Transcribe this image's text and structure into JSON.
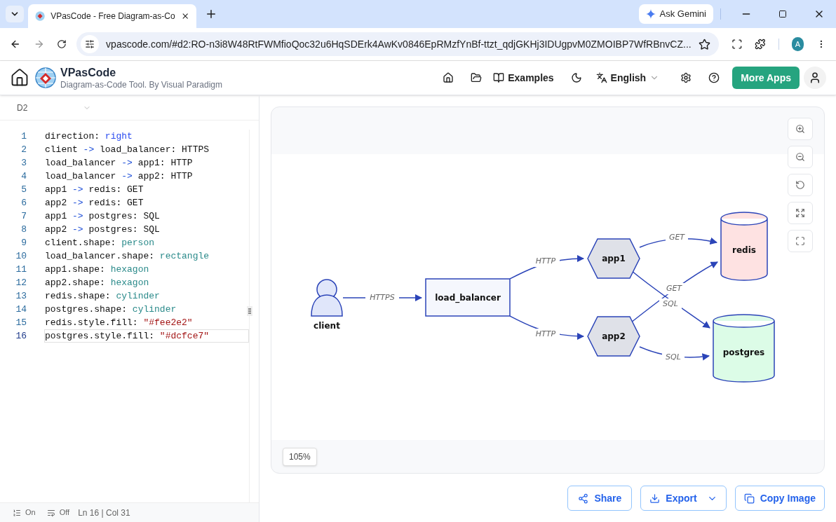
{
  "browser": {
    "tabs": [
      {
        "title": "VPasCode - Free Diagram-as-Co",
        "selected": true
      }
    ],
    "ask_gemini": "Ask Gemini",
    "url": "vpascode.com/#d2:RO-n3i8W48RtFWMfioQoc32u6HqSDErk4AwKv0846EpRMzfYnBf-ttzt_qdjGKHj3IDUgpvM0ZMOIBP7WfRBnvCZ...",
    "profile": "A"
  },
  "header": {
    "app_name": "VPasCode",
    "tagline": "Diagram-as-Code Tool. By Visual Paradigm",
    "examples": "Examples",
    "language": "English",
    "more_apps": "More Apps"
  },
  "editor": {
    "language": "D2",
    "lines": [
      {
        "number": "1",
        "selected": false,
        "tokens": [
          {
            "text": "direction: ",
            "kind": "plain"
          },
          {
            "text": "right",
            "kind": "keyword"
          }
        ]
      },
      {
        "number": "2",
        "selected": false,
        "tokens": [
          {
            "text": "client ",
            "kind": "plain"
          },
          {
            "text": "->",
            "kind": "arrow"
          },
          {
            "text": " load_balancer: HTTPS",
            "kind": "plain"
          }
        ]
      },
      {
        "number": "3",
        "selected": false,
        "tokens": [
          {
            "text": "load_balancer ",
            "kind": "plain"
          },
          {
            "text": "->",
            "kind": "arrow"
          },
          {
            "text": " app1: HTTP",
            "kind": "plain"
          }
        ]
      },
      {
        "number": "4",
        "selected": false,
        "tokens": [
          {
            "text": "load_balancer ",
            "kind": "plain"
          },
          {
            "text": "->",
            "kind": "arrow"
          },
          {
            "text": " app2: HTTP",
            "kind": "plain"
          }
        ]
      },
      {
        "number": "5",
        "selected": false,
        "tokens": [
          {
            "text": "app1 ",
            "kind": "plain"
          },
          {
            "text": "->",
            "kind": "arrow"
          },
          {
            "text": " redis: GET",
            "kind": "plain"
          }
        ]
      },
      {
        "number": "6",
        "selected": false,
        "tokens": [
          {
            "text": "app2 ",
            "kind": "plain"
          },
          {
            "text": "->",
            "kind": "arrow"
          },
          {
            "text": " redis: GET",
            "kind": "plain"
          }
        ]
      },
      {
        "number": "7",
        "selected": false,
        "tokens": [
          {
            "text": "app1 ",
            "kind": "plain"
          },
          {
            "text": "->",
            "kind": "arrow"
          },
          {
            "text": " postgres: SQL",
            "kind": "plain"
          }
        ]
      },
      {
        "number": "8",
        "selected": false,
        "tokens": [
          {
            "text": "app2 ",
            "kind": "plain"
          },
          {
            "text": "->",
            "kind": "arrow"
          },
          {
            "text": " postgres: SQL",
            "kind": "plain"
          }
        ]
      },
      {
        "number": "9",
        "selected": false,
        "tokens": [
          {
            "text": "client.shape: ",
            "kind": "plain"
          },
          {
            "text": "person",
            "kind": "value"
          }
        ]
      },
      {
        "number": "10",
        "selected": false,
        "tokens": [
          {
            "text": "load_balancer.shape: ",
            "kind": "plain"
          },
          {
            "text": "rectangle",
            "kind": "value"
          }
        ]
      },
      {
        "number": "11",
        "selected": false,
        "tokens": [
          {
            "text": "app1.shape: ",
            "kind": "plain"
          },
          {
            "text": "hexagon",
            "kind": "value"
          }
        ]
      },
      {
        "number": "12",
        "selected": false,
        "tokens": [
          {
            "text": "app2.shape: ",
            "kind": "plain"
          },
          {
            "text": "hexagon",
            "kind": "value"
          }
        ]
      },
      {
        "number": "13",
        "selected": false,
        "tokens": [
          {
            "text": "redis.shape: ",
            "kind": "plain"
          },
          {
            "text": "cylinder",
            "kind": "value"
          }
        ]
      },
      {
        "number": "14",
        "selected": false,
        "tokens": [
          {
            "text": "postgres.shape: ",
            "kind": "plain"
          },
          {
            "text": "cylinder",
            "kind": "value"
          }
        ]
      },
      {
        "number": "15",
        "selected": false,
        "tokens": [
          {
            "text": "redis.style.fill: ",
            "kind": "plain"
          },
          {
            "text": "\"#fee2e2\"",
            "kind": "string"
          }
        ]
      },
      {
        "number": "16",
        "selected": true,
        "tokens": [
          {
            "text": "postgres.style.fill: ",
            "kind": "plain"
          },
          {
            "text": "\"#dcfce7\"",
            "kind": "string"
          }
        ]
      }
    ],
    "line_numbers": "On",
    "word_wrap": "Off",
    "cursor": "Ln 16 | Col 31"
  },
  "diagram": {
    "nodes": [
      {
        "label": "client",
        "kind": "person",
        "color": "#e0e6fa"
      },
      {
        "label": "load_balancer",
        "kind": "rectangle",
        "color": "#f5f7fd"
      },
      {
        "label": "app1",
        "kind": "hexagon",
        "color": "#dfe1e8"
      },
      {
        "label": "app2",
        "kind": "hexagon",
        "color": "#dfe1e8"
      },
      {
        "label": "redis",
        "kind": "cylinder",
        "color": "#fee2e2"
      },
      {
        "label": "postgres",
        "kind": "cylinder",
        "color": "#dcfce7"
      }
    ],
    "edges": [
      {
        "label": "HTTPS"
      },
      {
        "label": "HTTP"
      },
      {
        "label": "HTTP"
      },
      {
        "label": "GET"
      },
      {
        "label": "GET"
      },
      {
        "label": "SQL"
      },
      {
        "label": "SQL"
      }
    ],
    "zoom": "105%"
  },
  "actions": {
    "share": "Share",
    "export": "Export",
    "copy_image": "Copy Image"
  }
}
